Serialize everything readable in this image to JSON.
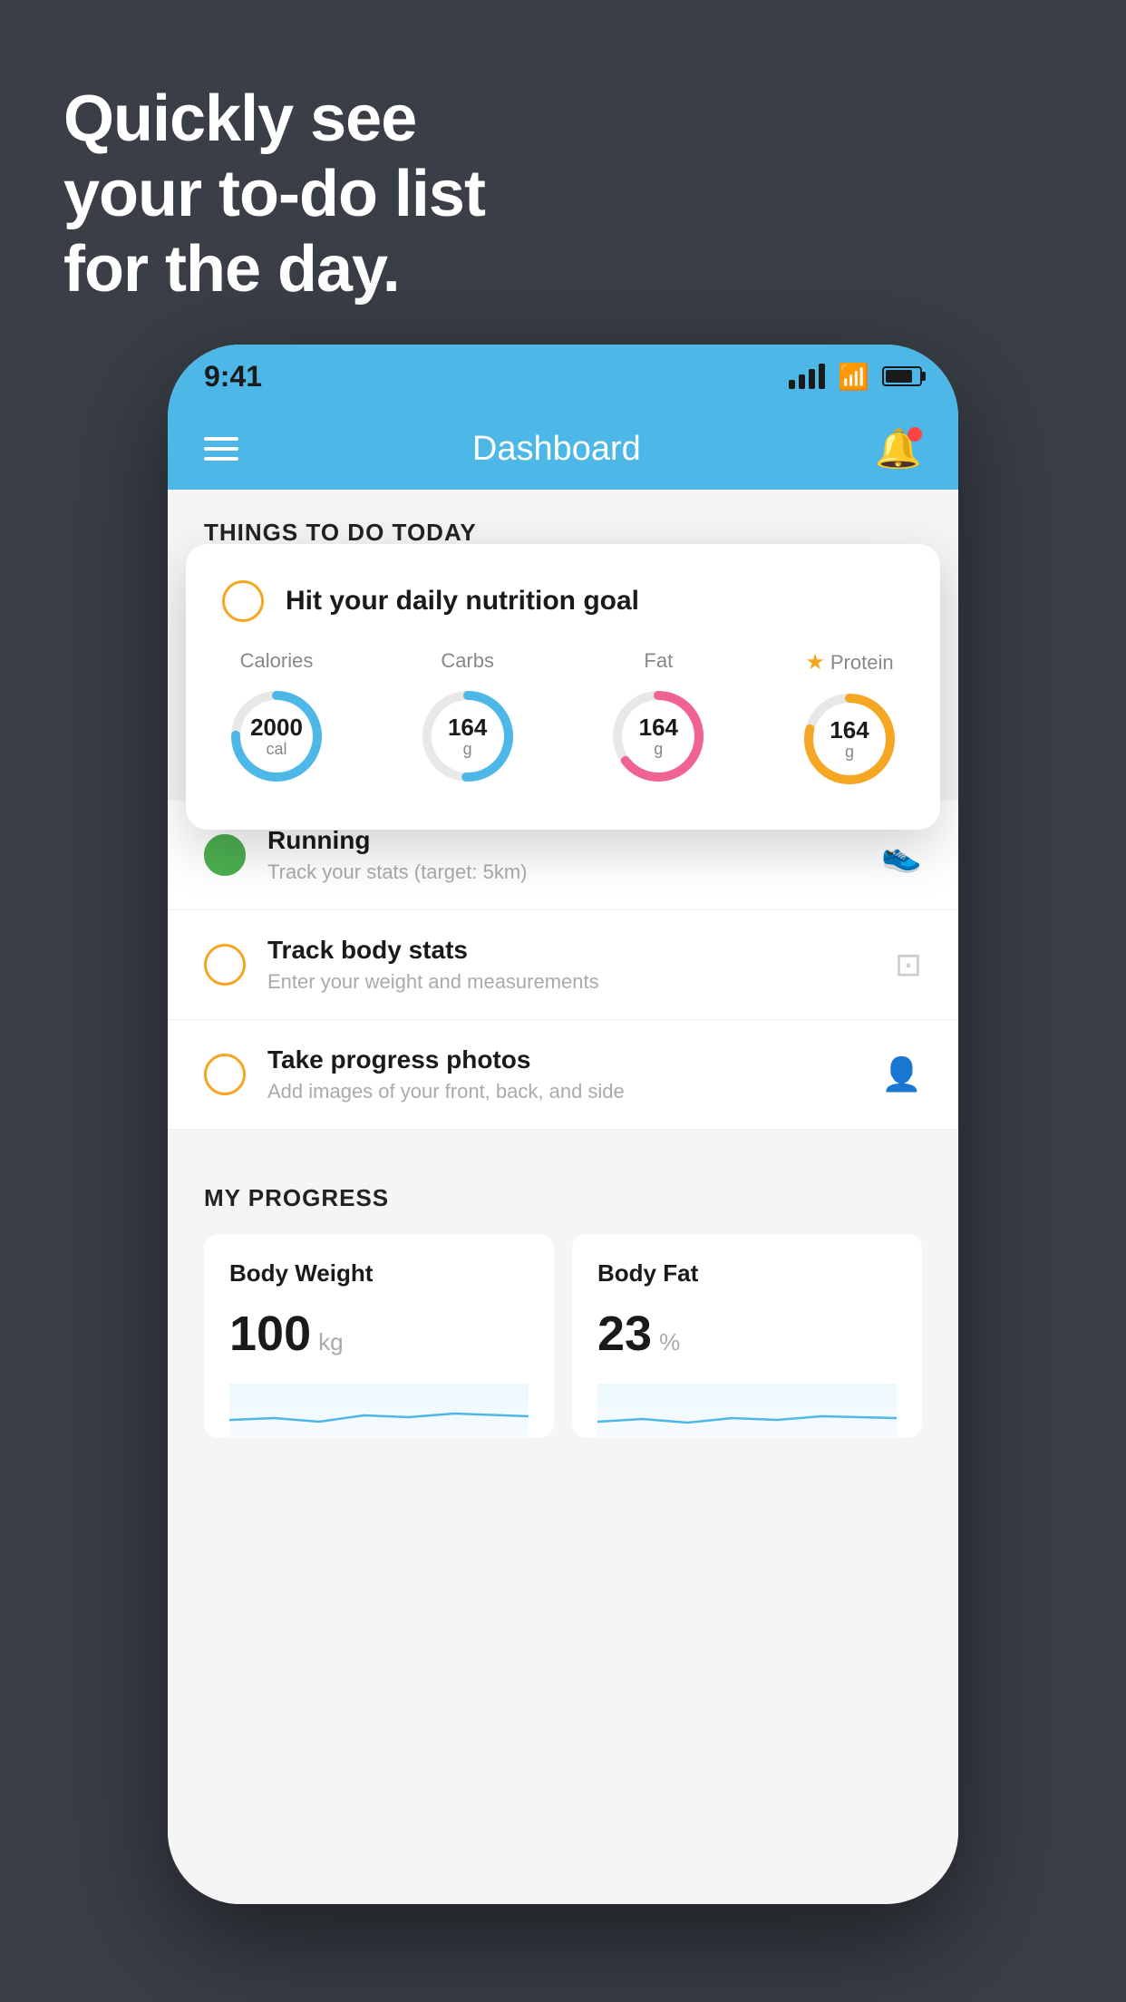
{
  "hero": {
    "line1": "Quickly see",
    "line2": "your to-do list",
    "line3": "for the day."
  },
  "phone": {
    "status": {
      "time": "9:41"
    },
    "header": {
      "title": "Dashboard"
    },
    "sections": {
      "todo_title": "THINGS TO DO TODAY",
      "progress_title": "MY PROGRESS"
    },
    "floating_card": {
      "title": "Hit your daily nutrition goal",
      "nutrition": [
        {
          "label": "Calories",
          "value": "2000",
          "unit": "cal",
          "type": "blue"
        },
        {
          "label": "Carbs",
          "value": "164",
          "unit": "g",
          "type": "blue"
        },
        {
          "label": "Fat",
          "value": "164",
          "unit": "g",
          "type": "pink"
        },
        {
          "label": "Protein",
          "value": "164",
          "unit": "g",
          "type": "yellow"
        }
      ]
    },
    "todo_items": [
      {
        "title": "Running",
        "subtitle": "Track your stats (target: 5km)",
        "status": "complete",
        "icon": "shoe"
      },
      {
        "title": "Track body stats",
        "subtitle": "Enter your weight and measurements",
        "status": "incomplete",
        "icon": "scale"
      },
      {
        "title": "Take progress photos",
        "subtitle": "Add images of your front, back, and side",
        "status": "incomplete",
        "icon": "photo"
      }
    ],
    "progress_cards": [
      {
        "title": "Body Weight",
        "value": "100",
        "unit": "kg"
      },
      {
        "title": "Body Fat",
        "value": "23",
        "unit": "%"
      }
    ]
  }
}
